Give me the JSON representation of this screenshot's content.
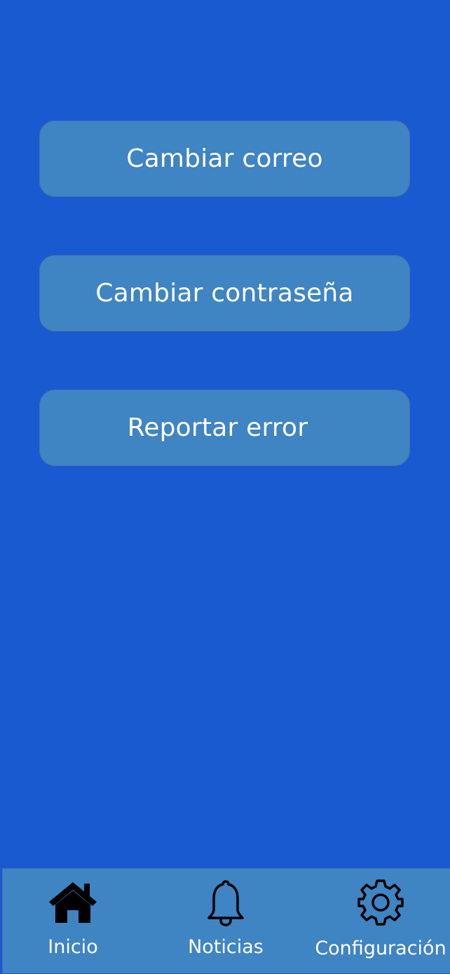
{
  "menu": {
    "buttons": [
      {
        "label": "Cambiar correo"
      },
      {
        "label": "Cambiar contraseña"
      },
      {
        "label": "Reportar error"
      }
    ]
  },
  "bottom_nav": {
    "items": [
      {
        "label": "Inicio",
        "icon": "home-icon"
      },
      {
        "label": "Noticias",
        "icon": "bell-icon"
      },
      {
        "label": "Configuración",
        "icon": "gear-icon"
      }
    ]
  },
  "colors": {
    "background": "#1a5ad0",
    "button": "#3f84c3",
    "text": "#ffffff",
    "icon": "#000000"
  }
}
